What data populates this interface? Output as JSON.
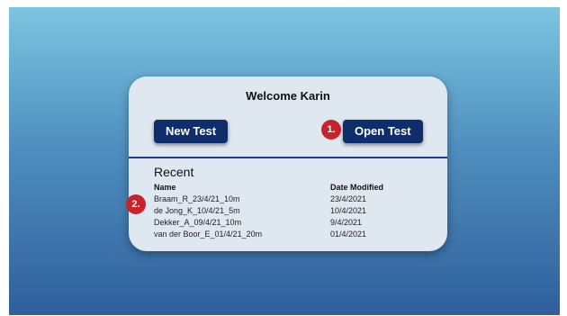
{
  "welcome": "Welcome Karin",
  "buttons": {
    "new_test": "New Test",
    "open_test": "Open Test"
  },
  "annotations": {
    "one": "1.",
    "two": "2."
  },
  "recent": {
    "title": "Recent",
    "columns": {
      "name": "Name",
      "date": "Date Modified"
    },
    "rows": [
      {
        "name": "Braam_R_23/4/21_10m",
        "date": "23/4/2021"
      },
      {
        "name": "de Jong_K_10/4/21_5m",
        "date": "10/4/2021"
      },
      {
        "name": "Dekker_A_09/4/21_10m",
        "date": "9/4/2021"
      },
      {
        "name": "van der Boor_E_01/4/21_20m",
        "date": "01/4/2021"
      }
    ]
  },
  "colors": {
    "button": "#0f2d6b",
    "badge": "#c8232b",
    "divider": "#1b3f8a",
    "card": "#dfe8f1"
  }
}
